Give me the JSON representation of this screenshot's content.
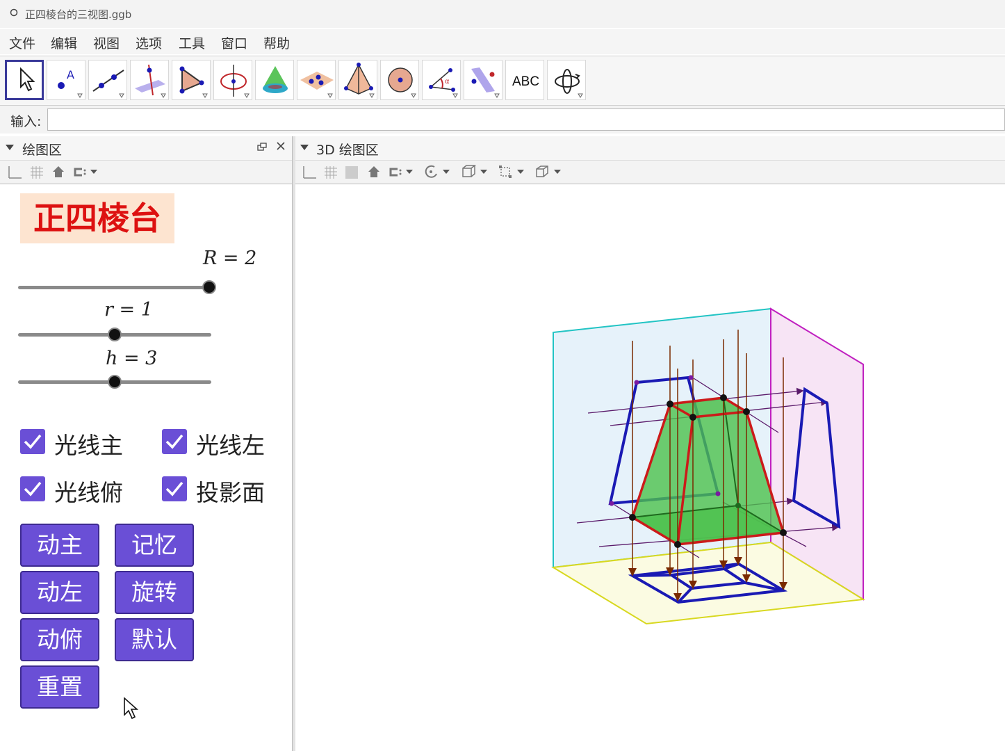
{
  "window": {
    "title": "正四棱台的三视图.ggb"
  },
  "menu": [
    "文件",
    "编辑",
    "视图",
    "选项",
    "工具",
    "窗口",
    "帮助"
  ],
  "toolbar": {
    "abc_label": "ABC"
  },
  "input": {
    "label": "输入:",
    "value": ""
  },
  "left_panel": {
    "title": "绘图区"
  },
  "right_panel": {
    "title": "3D 绘图区"
  },
  "graphics": {
    "title": "正四棱台",
    "sliders": [
      {
        "label": "R = 2",
        "value": 2,
        "fraction": 1.0
      },
      {
        "label": "r = 1",
        "value": 1,
        "fraction": 0.5
      },
      {
        "label": "h = 3",
        "value": 3,
        "fraction": 0.5
      }
    ],
    "checkboxes": [
      {
        "label": "光线主",
        "checked": true
      },
      {
        "label": "光线左",
        "checked": true
      },
      {
        "label": "光线俯",
        "checked": true
      },
      {
        "label": "投影面",
        "checked": true
      }
    ],
    "buttons": [
      "动主",
      "记忆",
      "动左",
      "旋转",
      "动俯",
      "默认",
      "重置"
    ]
  },
  "colors": {
    "checkbox": "#6a4fd6",
    "button": "#6a4fd6",
    "title_text": "#dd1111",
    "title_bg": "#fde4d0",
    "frustum_edge": "#cc1a1a",
    "frustum_fill": "#4cc04c",
    "projection": "#1a1ab4",
    "ray": "#7a2a00"
  }
}
